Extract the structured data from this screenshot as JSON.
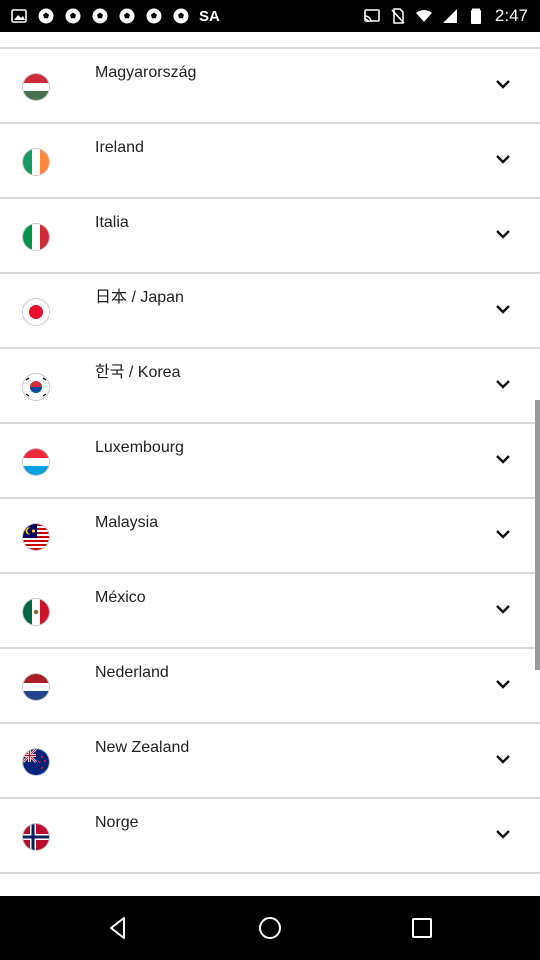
{
  "status_bar": {
    "left_icons": [
      "image-icon",
      "soccer-ball-icon",
      "soccer-ball-icon",
      "soccer-ball-icon",
      "soccer-ball-icon",
      "soccer-ball-icon",
      "soccer-ball-icon"
    ],
    "carrier": "SA",
    "time": "2:47",
    "right_icons": [
      "cast-icon",
      "no-sim-icon",
      "wifi-icon",
      "signal-icon",
      "battery-icon"
    ]
  },
  "countries": [
    {
      "name": "Magyarország",
      "flag": "hungary-flag-icon"
    },
    {
      "name": "Ireland",
      "flag": "ireland-flag-icon"
    },
    {
      "name": "Italia",
      "flag": "italy-flag-icon"
    },
    {
      "name": "日本 / Japan",
      "flag": "japan-flag-icon"
    },
    {
      "name": "한국 / Korea",
      "flag": "korea-flag-icon"
    },
    {
      "name": "Luxembourg",
      "flag": "luxembourg-flag-icon"
    },
    {
      "name": "Malaysia",
      "flag": "malaysia-flag-icon"
    },
    {
      "name": "México",
      "flag": "mexico-flag-icon"
    },
    {
      "name": "Nederland",
      "flag": "netherlands-flag-icon"
    },
    {
      "name": "New Zealand",
      "flag": "new-zealand-flag-icon"
    },
    {
      "name": "Norge",
      "flag": "norway-flag-icon"
    }
  ],
  "nav_bar": {
    "buttons": [
      "back-icon",
      "home-icon",
      "recents-icon"
    ]
  },
  "colors": {
    "status_bar_bg": "#000000",
    "nav_bar_bg": "#000000",
    "divider": "#d8d8d8",
    "text": "#222222"
  }
}
